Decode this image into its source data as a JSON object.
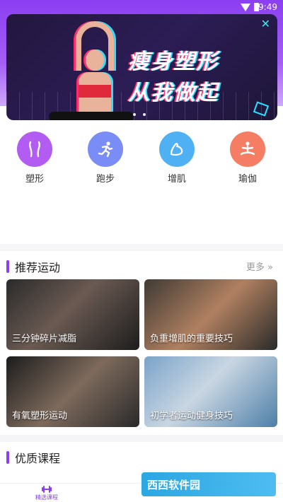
{
  "status_bar": {
    "time": "9:49"
  },
  "banner": {
    "title_line1": "瘦身塑形",
    "title_line2": "从我做起"
  },
  "categories": [
    {
      "label": "塑形",
      "icon": "shaping-icon",
      "color": "#b25cf1"
    },
    {
      "label": "跑步",
      "icon": "running-icon",
      "color": "#7a8cf5"
    },
    {
      "label": "增肌",
      "icon": "muscle-icon",
      "color": "#4fb0f3"
    },
    {
      "label": "瑜伽",
      "icon": "yoga-icon",
      "color": "#f47d63"
    }
  ],
  "recommended": {
    "title": "推荐运动",
    "more_label": "更多 »",
    "cards": [
      {
        "label": "三分钟碎片减脂"
      },
      {
        "label": "负重增肌的重要技巧"
      },
      {
        "label": "有氧塑形运动"
      },
      {
        "label": "初学者运动健身技巧"
      }
    ]
  },
  "quality": {
    "title": "优质课程"
  },
  "bottom_nav": {
    "items": [
      {
        "label": "精选课程",
        "active": true
      }
    ]
  },
  "watermark": {
    "text": "西西软件园"
  },
  "colors": {
    "accent": "#8b3ff2"
  }
}
